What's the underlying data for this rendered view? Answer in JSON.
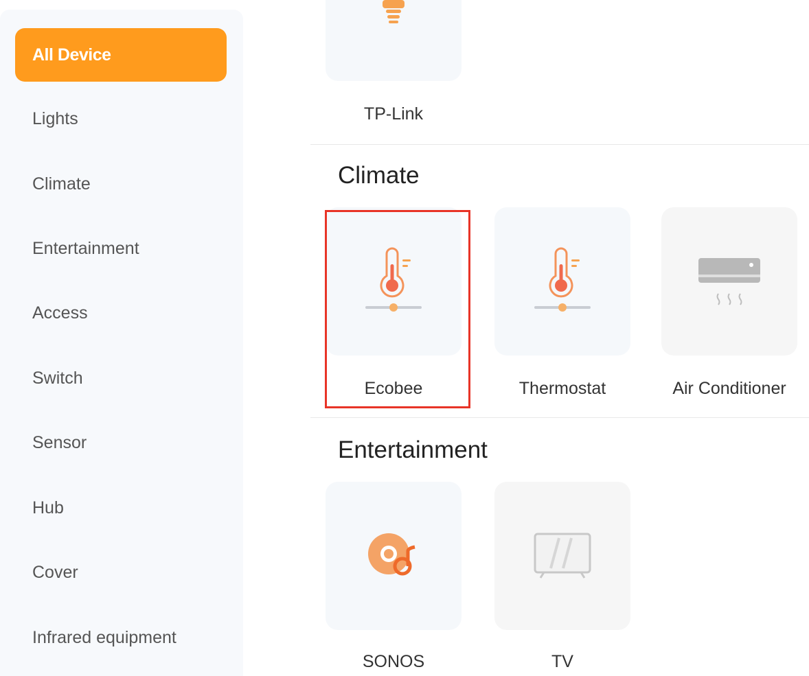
{
  "sidebar": {
    "items": [
      {
        "label": "All Device",
        "active": true
      },
      {
        "label": "Lights"
      },
      {
        "label": "Climate"
      },
      {
        "label": "Entertainment"
      },
      {
        "label": "Access"
      },
      {
        "label": "Switch"
      },
      {
        "label": "Sensor"
      },
      {
        "label": "Hub"
      },
      {
        "label": "Cover"
      },
      {
        "label": "Infrared equipment"
      }
    ]
  },
  "sections": {
    "lights": {
      "devices": [
        {
          "label": "TP-Link",
          "icon": "bulb-icon"
        }
      ]
    },
    "climate": {
      "title": "Climate",
      "devices": [
        {
          "label": "Ecobee",
          "icon": "thermometer-icon",
          "selected": true
        },
        {
          "label": "Thermostat",
          "icon": "thermometer-icon"
        },
        {
          "label": "Air Conditioner",
          "icon": "air-conditioner-icon"
        }
      ]
    },
    "entertainment": {
      "title": "Entertainment",
      "devices": [
        {
          "label": "SONOS",
          "icon": "speaker-disc-icon"
        },
        {
          "label": "TV",
          "icon": "tv-icon"
        }
      ]
    }
  },
  "colors": {
    "accent": "#ff9b1d",
    "icon_orange": "#f4935a",
    "selection_border": "#e83427",
    "sidebar_bg": "#f7f9fc"
  }
}
